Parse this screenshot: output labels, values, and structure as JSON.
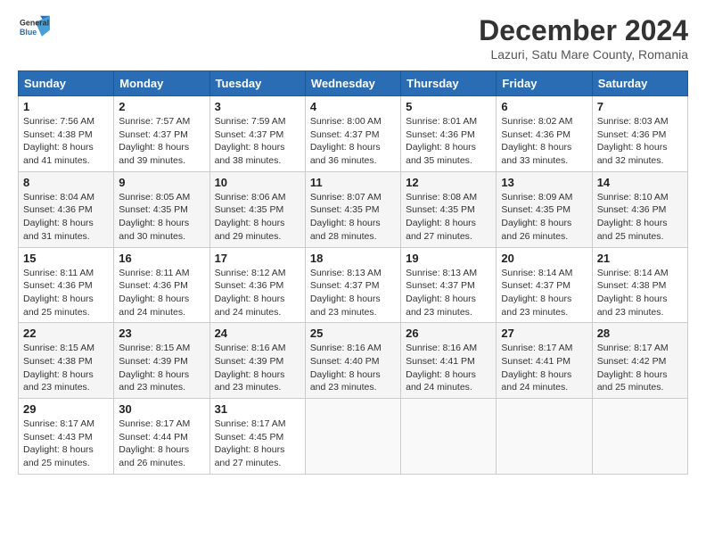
{
  "header": {
    "logo_line1": "General",
    "logo_line2": "Blue",
    "title": "December 2024",
    "subtitle": "Lazuri, Satu Mare County, Romania"
  },
  "weekdays": [
    "Sunday",
    "Monday",
    "Tuesday",
    "Wednesday",
    "Thursday",
    "Friday",
    "Saturday"
  ],
  "weeks": [
    [
      {
        "day": "1",
        "info": "Sunrise: 7:56 AM\nSunset: 4:38 PM\nDaylight: 8 hours and 41 minutes."
      },
      {
        "day": "2",
        "info": "Sunrise: 7:57 AM\nSunset: 4:37 PM\nDaylight: 8 hours and 39 minutes."
      },
      {
        "day": "3",
        "info": "Sunrise: 7:59 AM\nSunset: 4:37 PM\nDaylight: 8 hours and 38 minutes."
      },
      {
        "day": "4",
        "info": "Sunrise: 8:00 AM\nSunset: 4:37 PM\nDaylight: 8 hours and 36 minutes."
      },
      {
        "day": "5",
        "info": "Sunrise: 8:01 AM\nSunset: 4:36 PM\nDaylight: 8 hours and 35 minutes."
      },
      {
        "day": "6",
        "info": "Sunrise: 8:02 AM\nSunset: 4:36 PM\nDaylight: 8 hours and 33 minutes."
      },
      {
        "day": "7",
        "info": "Sunrise: 8:03 AM\nSunset: 4:36 PM\nDaylight: 8 hours and 32 minutes."
      }
    ],
    [
      {
        "day": "8",
        "info": "Sunrise: 8:04 AM\nSunset: 4:36 PM\nDaylight: 8 hours and 31 minutes."
      },
      {
        "day": "9",
        "info": "Sunrise: 8:05 AM\nSunset: 4:35 PM\nDaylight: 8 hours and 30 minutes."
      },
      {
        "day": "10",
        "info": "Sunrise: 8:06 AM\nSunset: 4:35 PM\nDaylight: 8 hours and 29 minutes."
      },
      {
        "day": "11",
        "info": "Sunrise: 8:07 AM\nSunset: 4:35 PM\nDaylight: 8 hours and 28 minutes."
      },
      {
        "day": "12",
        "info": "Sunrise: 8:08 AM\nSunset: 4:35 PM\nDaylight: 8 hours and 27 minutes."
      },
      {
        "day": "13",
        "info": "Sunrise: 8:09 AM\nSunset: 4:35 PM\nDaylight: 8 hours and 26 minutes."
      },
      {
        "day": "14",
        "info": "Sunrise: 8:10 AM\nSunset: 4:36 PM\nDaylight: 8 hours and 25 minutes."
      }
    ],
    [
      {
        "day": "15",
        "info": "Sunrise: 8:11 AM\nSunset: 4:36 PM\nDaylight: 8 hours and 25 minutes."
      },
      {
        "day": "16",
        "info": "Sunrise: 8:11 AM\nSunset: 4:36 PM\nDaylight: 8 hours and 24 minutes."
      },
      {
        "day": "17",
        "info": "Sunrise: 8:12 AM\nSunset: 4:36 PM\nDaylight: 8 hours and 24 minutes."
      },
      {
        "day": "18",
        "info": "Sunrise: 8:13 AM\nSunset: 4:37 PM\nDaylight: 8 hours and 23 minutes."
      },
      {
        "day": "19",
        "info": "Sunrise: 8:13 AM\nSunset: 4:37 PM\nDaylight: 8 hours and 23 minutes."
      },
      {
        "day": "20",
        "info": "Sunrise: 8:14 AM\nSunset: 4:37 PM\nDaylight: 8 hours and 23 minutes."
      },
      {
        "day": "21",
        "info": "Sunrise: 8:14 AM\nSunset: 4:38 PM\nDaylight: 8 hours and 23 minutes."
      }
    ],
    [
      {
        "day": "22",
        "info": "Sunrise: 8:15 AM\nSunset: 4:38 PM\nDaylight: 8 hours and 23 minutes."
      },
      {
        "day": "23",
        "info": "Sunrise: 8:15 AM\nSunset: 4:39 PM\nDaylight: 8 hours and 23 minutes."
      },
      {
        "day": "24",
        "info": "Sunrise: 8:16 AM\nSunset: 4:39 PM\nDaylight: 8 hours and 23 minutes."
      },
      {
        "day": "25",
        "info": "Sunrise: 8:16 AM\nSunset: 4:40 PM\nDaylight: 8 hours and 23 minutes."
      },
      {
        "day": "26",
        "info": "Sunrise: 8:16 AM\nSunset: 4:41 PM\nDaylight: 8 hours and 24 minutes."
      },
      {
        "day": "27",
        "info": "Sunrise: 8:17 AM\nSunset: 4:41 PM\nDaylight: 8 hours and 24 minutes."
      },
      {
        "day": "28",
        "info": "Sunrise: 8:17 AM\nSunset: 4:42 PM\nDaylight: 8 hours and 25 minutes."
      }
    ],
    [
      {
        "day": "29",
        "info": "Sunrise: 8:17 AM\nSunset: 4:43 PM\nDaylight: 8 hours and 25 minutes."
      },
      {
        "day": "30",
        "info": "Sunrise: 8:17 AM\nSunset: 4:44 PM\nDaylight: 8 hours and 26 minutes."
      },
      {
        "day": "31",
        "info": "Sunrise: 8:17 AM\nSunset: 4:45 PM\nDaylight: 8 hours and 27 minutes."
      },
      {
        "day": "",
        "info": ""
      },
      {
        "day": "",
        "info": ""
      },
      {
        "day": "",
        "info": ""
      },
      {
        "day": "",
        "info": ""
      }
    ]
  ]
}
